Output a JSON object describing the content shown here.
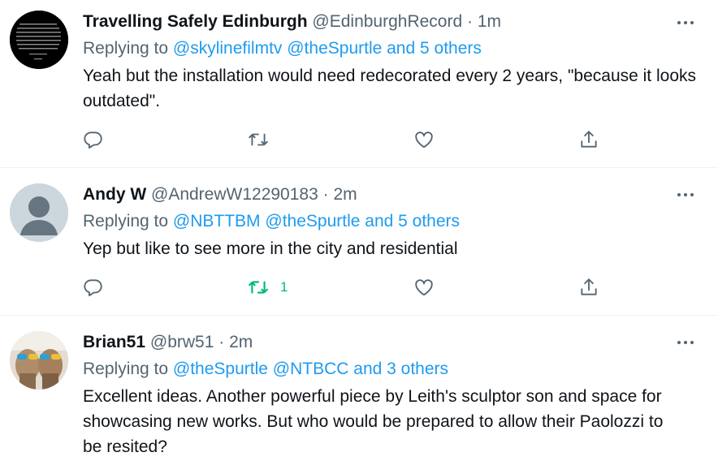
{
  "tweets": [
    {
      "name": "Travelling Safely Edinburgh",
      "handle": "@EdinburghRecord",
      "sep": "·",
      "time": "1m",
      "replying_prefix": "Replying to",
      "replying_to": "@skylinefilmtv @theSpurtle and 5 others",
      "text": "Yeah but the installation would need redecorated every 2 years, \"because it looks outdated\".",
      "retweets": ""
    },
    {
      "name": "Andy W",
      "handle": "@AndrewW12290183",
      "sep": "·",
      "time": "2m",
      "replying_prefix": "Replying to",
      "replying_to": "@NBTTBM @theSpurtle and 5 others",
      "text": "Yep but like to see more in the city and residential",
      "retweets": "1"
    },
    {
      "name": "Brian51",
      "handle": "@brw51",
      "sep": "·",
      "time": "2m",
      "replying_prefix": "Replying to",
      "replying_to": "@theSpurtle @NTBCC and 3 others",
      "text": "Excellent ideas.  Another powerful piece by Leith's sculptor son and space for showcasing new works.  But who would be prepared to allow their Paolozzi to be resited?",
      "retweets": ""
    }
  ],
  "colors": {
    "link": "#1d9bf0",
    "secondary_text": "#536471",
    "retweet_active": "#00ba7c",
    "icon": "#536471"
  },
  "icons": [
    "reply-icon",
    "retweet-icon",
    "like-icon",
    "share-icon",
    "more-icon"
  ]
}
